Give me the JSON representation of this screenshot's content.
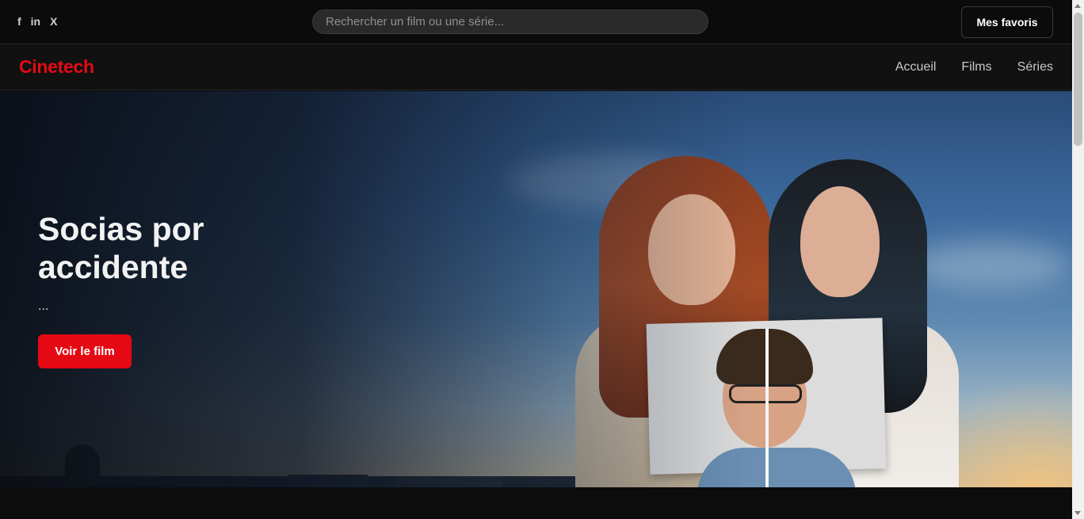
{
  "header": {
    "socials": [
      {
        "label": "f",
        "icon": "facebook-icon"
      },
      {
        "label": "in",
        "icon": "linkedin-icon"
      },
      {
        "label": "X",
        "icon": "x-icon"
      }
    ],
    "search_placeholder": "Rechercher un film ou une série...",
    "favorites_label": "Mes favoris"
  },
  "nav": {
    "logo": "Cinetech",
    "links": [
      "Accueil",
      "Films",
      "Séries"
    ]
  },
  "hero": {
    "title": "Socias por accidente",
    "description": "...",
    "cta_label": "Voir le film"
  },
  "colors": {
    "accent": "#e50914",
    "background": "#0c0c0c",
    "nav_background": "#111111"
  }
}
